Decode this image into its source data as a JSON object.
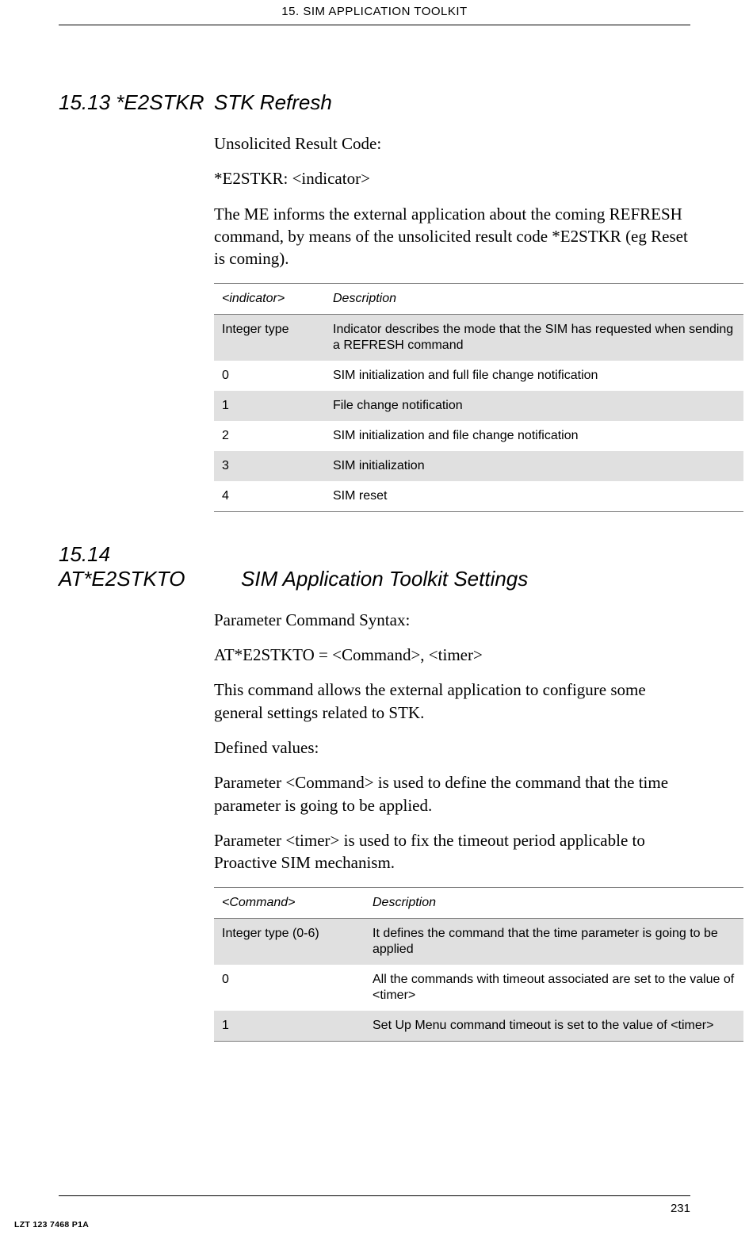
{
  "header": "15. SIM APPLICATION TOOLKIT",
  "section1": {
    "number": "15.13 *E2STKR",
    "title": "STK Refresh",
    "p1": "Unsolicited Result Code:",
    "p2": "*E2STKR: <indicator>",
    "p3": "The ME informs the external application about the coming REFRESH command, by means of the unsolicited result code *E2STKR (eg Reset is coming).",
    "table": {
      "h1": "<indicator>",
      "h2": "Description",
      "rows": [
        {
          "c1": "Integer type",
          "c2": "Indicator describes the mode that the SIM has requested when sending a REFRESH command"
        },
        {
          "c1": "0",
          "c2": "SIM initialization and full file change notification"
        },
        {
          "c1": "1",
          "c2": "File change notification"
        },
        {
          "c1": "2",
          "c2": "SIM initialization and file change notification"
        },
        {
          "c1": "3",
          "c2": "SIM initialization"
        },
        {
          "c1": "4",
          "c2": "SIM reset"
        }
      ]
    }
  },
  "section2": {
    "number": "15.14 AT*E2STKTO",
    "title": "SIM Application Toolkit Settings",
    "p1": "Parameter Command Syntax:",
    "p2": "AT*E2STKTO = <Command>, <timer>",
    "p3": "This command allows the external application to configure some general settings related to STK.",
    "p4": "Defined values:",
    "p5": "Parameter <Command> is used to define the command that the time parameter is going to be applied.",
    "p6": "Parameter <timer> is used to fix the timeout period applicable to Proactive SIM mechanism.",
    "table": {
      "h1": "<Command>",
      "h2": "Description",
      "rows": [
        {
          "c1": "Integer type (0-6)",
          "c2": "It defines the command that the time parameter is going to be applied"
        },
        {
          "c1": "0",
          "c2": "All the commands with timeout associated are set to the value of <timer>"
        },
        {
          "c1": "1",
          "c2": "Set Up Menu command timeout is set to the value of <timer>"
        }
      ]
    }
  },
  "footer": {
    "page": "231",
    "docid": "LZT 123 7468 P1A"
  }
}
